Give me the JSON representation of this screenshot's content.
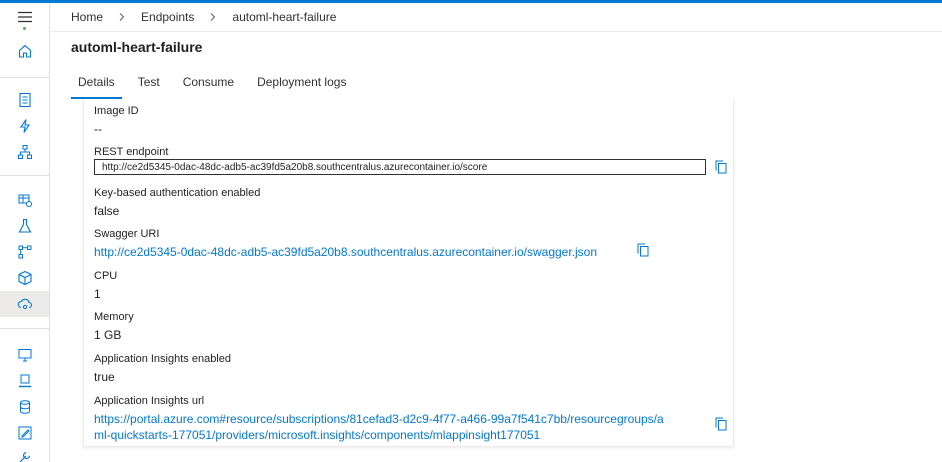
{
  "breadcrumb": {
    "home": "Home",
    "endpoints": "Endpoints",
    "current": "automl-heart-failure"
  },
  "page_title": "automl-heart-failure",
  "tabs": [
    {
      "label": "Details",
      "active": true
    },
    {
      "label": "Test",
      "active": false
    },
    {
      "label": "Consume",
      "active": false
    },
    {
      "label": "Deployment logs",
      "active": false
    }
  ],
  "details": {
    "image_id": {
      "label": "Image ID",
      "value": "--"
    },
    "rest_endpoint": {
      "label": "REST endpoint",
      "value": "http://ce2d5345-0dac-48dc-adb5-ac39fd5a20b8.southcentralus.azurecontainer.io/score"
    },
    "key_auth": {
      "label": "Key-based authentication enabled",
      "value": "false"
    },
    "swagger": {
      "label": "Swagger URI",
      "value": "http://ce2d5345-0dac-48dc-adb5-ac39fd5a20b8.southcentralus.azurecontainer.io/swagger.json"
    },
    "cpu": {
      "label": "CPU",
      "value": "1"
    },
    "memory": {
      "label": "Memory",
      "value": "1 GB"
    },
    "app_insights_enabled": {
      "label": "Application Insights enabled",
      "value": "true"
    },
    "app_insights_url": {
      "label": "Application Insights url",
      "line1": "https://portal.azure.com#resource/subscriptions/81cefad3-d2c9-4f77-a466-99a7f541c7bb/resourcegroups/a",
      "line2": "ml-quickstarts-177051/providers/microsoft.insights/components/mlappinsight177051"
    }
  },
  "colors": {
    "accent": "#0078d4",
    "link": "#0078d4",
    "text": "#201f1e",
    "rail_active": "#edebe9"
  },
  "rail_icons": [
    "hamburger-icon",
    "home-icon",
    "notebook-icon",
    "automl-icon",
    "designer-icon",
    "datasets-icon",
    "experiments-icon",
    "pipelines-icon",
    "models-icon",
    "endpoints-icon",
    "compute-icon",
    "environments-icon",
    "datastores-icon",
    "data-labeling-icon",
    "linked-services-icon"
  ]
}
